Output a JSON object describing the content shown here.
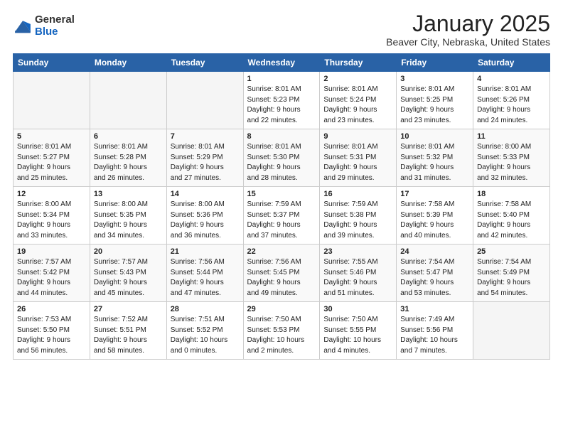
{
  "header": {
    "logo_general": "General",
    "logo_blue": "Blue",
    "month_title": "January 2025",
    "location": "Beaver City, Nebraska, United States"
  },
  "days_of_week": [
    "Sunday",
    "Monday",
    "Tuesday",
    "Wednesday",
    "Thursday",
    "Friday",
    "Saturday"
  ],
  "weeks": [
    [
      {
        "day": "",
        "empty": true
      },
      {
        "day": "",
        "empty": true
      },
      {
        "day": "",
        "empty": true
      },
      {
        "day": "1",
        "sunrise": "8:01 AM",
        "sunset": "5:23 PM",
        "daylight": "9 hours and 22 minutes."
      },
      {
        "day": "2",
        "sunrise": "8:01 AM",
        "sunset": "5:24 PM",
        "daylight": "9 hours and 23 minutes."
      },
      {
        "day": "3",
        "sunrise": "8:01 AM",
        "sunset": "5:25 PM",
        "daylight": "9 hours and 23 minutes."
      },
      {
        "day": "4",
        "sunrise": "8:01 AM",
        "sunset": "5:26 PM",
        "daylight": "9 hours and 24 minutes."
      }
    ],
    [
      {
        "day": "5",
        "sunrise": "8:01 AM",
        "sunset": "5:27 PM",
        "daylight": "9 hours and 25 minutes."
      },
      {
        "day": "6",
        "sunrise": "8:01 AM",
        "sunset": "5:28 PM",
        "daylight": "9 hours and 26 minutes."
      },
      {
        "day": "7",
        "sunrise": "8:01 AM",
        "sunset": "5:29 PM",
        "daylight": "9 hours and 27 minutes."
      },
      {
        "day": "8",
        "sunrise": "8:01 AM",
        "sunset": "5:30 PM",
        "daylight": "9 hours and 28 minutes."
      },
      {
        "day": "9",
        "sunrise": "8:01 AM",
        "sunset": "5:31 PM",
        "daylight": "9 hours and 29 minutes."
      },
      {
        "day": "10",
        "sunrise": "8:01 AM",
        "sunset": "5:32 PM",
        "daylight": "9 hours and 31 minutes."
      },
      {
        "day": "11",
        "sunrise": "8:00 AM",
        "sunset": "5:33 PM",
        "daylight": "9 hours and 32 minutes."
      }
    ],
    [
      {
        "day": "12",
        "sunrise": "8:00 AM",
        "sunset": "5:34 PM",
        "daylight": "9 hours and 33 minutes."
      },
      {
        "day": "13",
        "sunrise": "8:00 AM",
        "sunset": "5:35 PM",
        "daylight": "9 hours and 34 minutes."
      },
      {
        "day": "14",
        "sunrise": "8:00 AM",
        "sunset": "5:36 PM",
        "daylight": "9 hours and 36 minutes."
      },
      {
        "day": "15",
        "sunrise": "7:59 AM",
        "sunset": "5:37 PM",
        "daylight": "9 hours and 37 minutes."
      },
      {
        "day": "16",
        "sunrise": "7:59 AM",
        "sunset": "5:38 PM",
        "daylight": "9 hours and 39 minutes."
      },
      {
        "day": "17",
        "sunrise": "7:58 AM",
        "sunset": "5:39 PM",
        "daylight": "9 hours and 40 minutes."
      },
      {
        "day": "18",
        "sunrise": "7:58 AM",
        "sunset": "5:40 PM",
        "daylight": "9 hours and 42 minutes."
      }
    ],
    [
      {
        "day": "19",
        "sunrise": "7:57 AM",
        "sunset": "5:42 PM",
        "daylight": "9 hours and 44 minutes."
      },
      {
        "day": "20",
        "sunrise": "7:57 AM",
        "sunset": "5:43 PM",
        "daylight": "9 hours and 45 minutes."
      },
      {
        "day": "21",
        "sunrise": "7:56 AM",
        "sunset": "5:44 PM",
        "daylight": "9 hours and 47 minutes."
      },
      {
        "day": "22",
        "sunrise": "7:56 AM",
        "sunset": "5:45 PM",
        "daylight": "9 hours and 49 minutes."
      },
      {
        "day": "23",
        "sunrise": "7:55 AM",
        "sunset": "5:46 PM",
        "daylight": "9 hours and 51 minutes."
      },
      {
        "day": "24",
        "sunrise": "7:54 AM",
        "sunset": "5:47 PM",
        "daylight": "9 hours and 53 minutes."
      },
      {
        "day": "25",
        "sunrise": "7:54 AM",
        "sunset": "5:49 PM",
        "daylight": "9 hours and 54 minutes."
      }
    ],
    [
      {
        "day": "26",
        "sunrise": "7:53 AM",
        "sunset": "5:50 PM",
        "daylight": "9 hours and 56 minutes."
      },
      {
        "day": "27",
        "sunrise": "7:52 AM",
        "sunset": "5:51 PM",
        "daylight": "9 hours and 58 minutes."
      },
      {
        "day": "28",
        "sunrise": "7:51 AM",
        "sunset": "5:52 PM",
        "daylight": "10 hours and 0 minutes."
      },
      {
        "day": "29",
        "sunrise": "7:50 AM",
        "sunset": "5:53 PM",
        "daylight": "10 hours and 2 minutes."
      },
      {
        "day": "30",
        "sunrise": "7:50 AM",
        "sunset": "5:55 PM",
        "daylight": "10 hours and 4 minutes."
      },
      {
        "day": "31",
        "sunrise": "7:49 AM",
        "sunset": "5:56 PM",
        "daylight": "10 hours and 7 minutes."
      },
      {
        "day": "",
        "empty": true
      }
    ]
  ]
}
